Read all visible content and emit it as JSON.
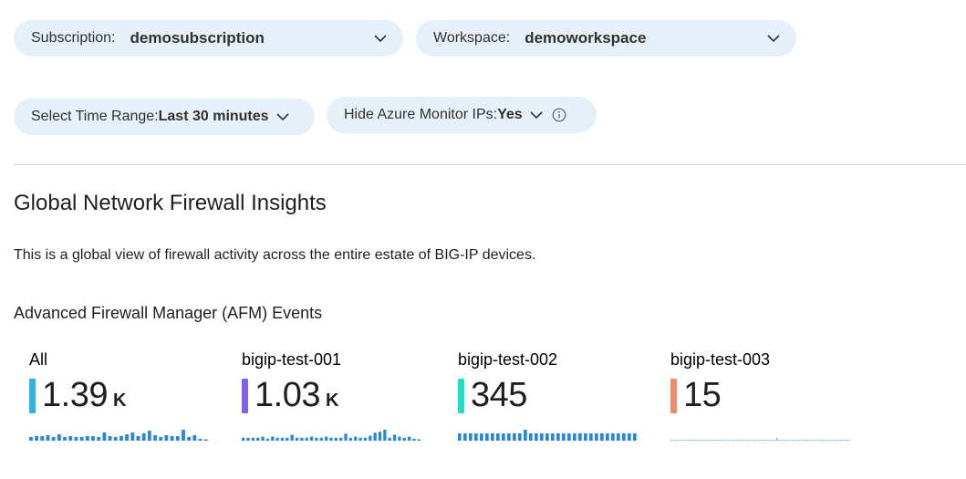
{
  "filters": {
    "subscription": {
      "label": "Subscription:",
      "value": "demosubscription",
      "icon": "chevron-down-icon"
    },
    "workspace": {
      "label": "Workspace:",
      "value": "demoworkspace",
      "icon": "chevron-down-icon"
    },
    "time_range": {
      "label": "Select Time Range: ",
      "value": "Last 30 minutes",
      "icon": "chevron-down-icon"
    },
    "hide_azure": {
      "label": "Hide Azure Monitor IPs: ",
      "value": "Yes",
      "icons": [
        "chevron-down-icon",
        "info-icon"
      ]
    }
  },
  "header": {
    "title": "Global Network Firewall Insights",
    "description": "This is a global view of firewall activity across the entire estate of BIG-IP devices."
  },
  "section": {
    "title": "Advanced Firewall Manager (AFM) Events"
  },
  "colors": {
    "pill_bg": "#e6f0f9",
    "spark": "#2b88d8",
    "spark_dashed": "#69a9e0"
  },
  "tiles": [
    {
      "name": "All",
      "value": "1.39",
      "unit": "K",
      "color": "#2eb4e8",
      "spark": [
        4,
        5,
        5,
        6,
        4,
        7,
        4,
        5,
        4,
        4,
        5,
        5,
        4,
        9,
        5,
        4,
        5,
        7,
        9,
        5,
        8,
        11,
        6,
        4,
        6,
        5,
        5,
        12,
        4,
        6,
        2,
        1
      ]
    },
    {
      "name": "bigip-test-001",
      "value": "1.03",
      "unit": "K",
      "color": "#8060f0",
      "spark": [
        3,
        3,
        3,
        3,
        4,
        2,
        4,
        3,
        3,
        3,
        6,
        3,
        3,
        3,
        4,
        3,
        3,
        4,
        3,
        3,
        3,
        7,
        3,
        4,
        3,
        3,
        5,
        8,
        9,
        11,
        3,
        6,
        4,
        3,
        4,
        2,
        1
      ]
    },
    {
      "name": "bigip-test-002",
      "value": "345",
      "unit": "",
      "color": "#1ee0c8",
      "spark": [
        2,
        2,
        2,
        2,
        2,
        2,
        2,
        2,
        2,
        2,
        2,
        2,
        3,
        2,
        2,
        2,
        2,
        2,
        2,
        2,
        2,
        2,
        2,
        2,
        2,
        2,
        2,
        2,
        2,
        2,
        2,
        2,
        2
      ]
    },
    {
      "name": "bigip-test-003",
      "value": "15",
      "unit": "",
      "color": "#f08c6e",
      "spark": [
        0,
        0,
        0,
        0,
        0,
        0,
        0,
        0,
        0,
        0,
        0,
        0,
        0,
        0,
        0,
        0,
        0,
        0,
        0,
        0,
        0,
        0,
        0,
        0,
        0,
        0,
        0,
        0,
        0,
        0,
        0,
        0,
        0,
        0,
        0,
        0,
        0,
        0,
        0,
        0,
        0,
        0,
        0,
        0,
        0,
        0,
        0,
        0,
        2,
        0,
        0,
        0,
        0,
        0,
        0,
        0,
        0,
        0,
        0,
        0,
        0,
        0,
        0,
        0,
        0,
        0,
        0,
        0,
        0,
        0,
        0,
        0,
        0,
        0,
        0,
        0,
        0,
        0,
        0,
        0,
        0,
        0
      ]
    }
  ]
}
